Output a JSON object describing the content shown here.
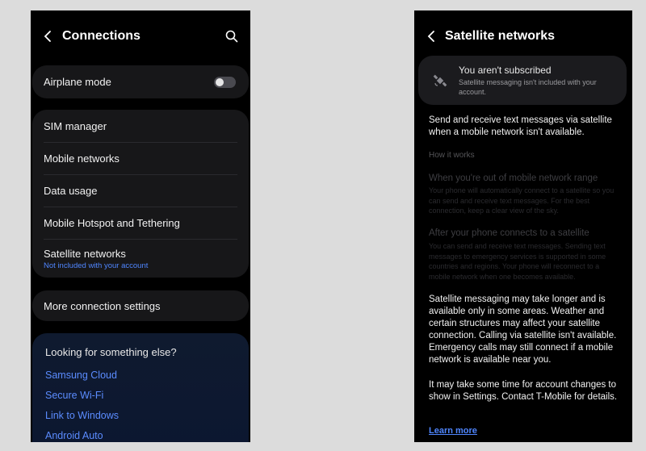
{
  "left": {
    "title": "Connections",
    "airplane": {
      "label": "Airplane mode",
      "enabled": false
    },
    "items": [
      {
        "label": "SIM manager"
      },
      {
        "label": "Mobile networks"
      },
      {
        "label": "Data usage"
      },
      {
        "label": "Mobile Hotspot and Tethering"
      },
      {
        "label": "Satellite networks",
        "subtitle": "Not included with your account"
      }
    ],
    "more": "More connection settings",
    "help": {
      "heading": "Looking for something else?",
      "links": [
        "Samsung Cloud",
        "Secure Wi-Fi",
        "Link to Windows",
        "Android Auto"
      ]
    }
  },
  "right": {
    "title": "Satellite networks",
    "status_card": {
      "title": "You aren't subscribed",
      "text": "Satellite messaging isn't included with your account."
    },
    "intro": "Send and receive text messages via satellite when a mobile network isn't available.",
    "how_it_works": "How it works",
    "step1_title": "When you're out of mobile network range",
    "step1_text": "Your phone will automatically connect to a satellite so you can send and receive text messages. For the best connection, keep a clear view of the sky.",
    "step2_title": "After your phone connects to a satellite",
    "step2_text": "You can send and receive text messages. Sending text messages to emergency services is supported in some countries and regions. Your phone will reconnect to a mobile network when one becomes available.",
    "note1": "Satellite messaging may take longer and is available only in some areas. Weather and certain structures may affect your satellite connection. Calling via satellite isn't available. Emergency calls may still connect if a mobile network is available near you.",
    "note2": "It may take some time for account changes to show in Settings. Contact T-Mobile for details.",
    "learn_more": "Learn more"
  },
  "colors": {
    "accent": "#4f86ff",
    "card": "#171719",
    "background": "#000000"
  }
}
